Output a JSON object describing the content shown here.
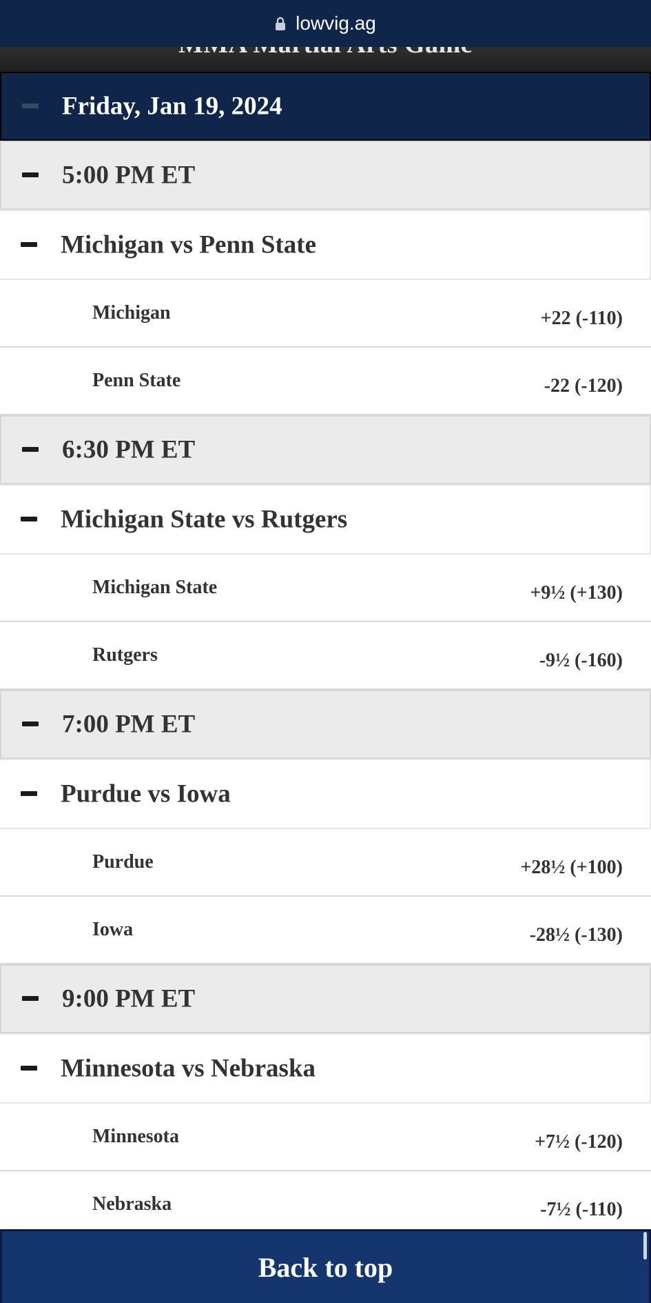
{
  "browser": {
    "url": "lowvig.ag"
  },
  "previous_header": "MMA Martial Arts Game",
  "date_header": "Friday, Jan 19, 2024",
  "schedule": [
    {
      "time": "5:00 PM ET",
      "game": "Michigan vs Penn State",
      "teams": [
        {
          "name": "Michigan",
          "line": "+22 (-110)"
        },
        {
          "name": "Penn State",
          "line": "-22 (-120)"
        }
      ]
    },
    {
      "time": "6:30 PM ET",
      "game": "Michigan State vs Rutgers",
      "teams": [
        {
          "name": "Michigan State",
          "line": "+9½ (+130)"
        },
        {
          "name": "Rutgers",
          "line": "-9½ (-160)"
        }
      ]
    },
    {
      "time": "7:00 PM ET",
      "game": "Purdue vs Iowa",
      "teams": [
        {
          "name": "Purdue",
          "line": "+28½ (+100)"
        },
        {
          "name": "Iowa",
          "line": "-28½ (-130)"
        }
      ]
    },
    {
      "time": "9:00 PM ET",
      "game": "Minnesota vs Nebraska",
      "teams": [
        {
          "name": "Minnesota",
          "line": "+7½ (-120)"
        },
        {
          "name": "Nebraska",
          "line": "-7½ (-110)"
        }
      ]
    }
  ],
  "back_to_top_label": "Back to top",
  "colors": {
    "navy": "#0f2549",
    "section_gray": "#ebebeb",
    "button_blue": "#14356e"
  }
}
